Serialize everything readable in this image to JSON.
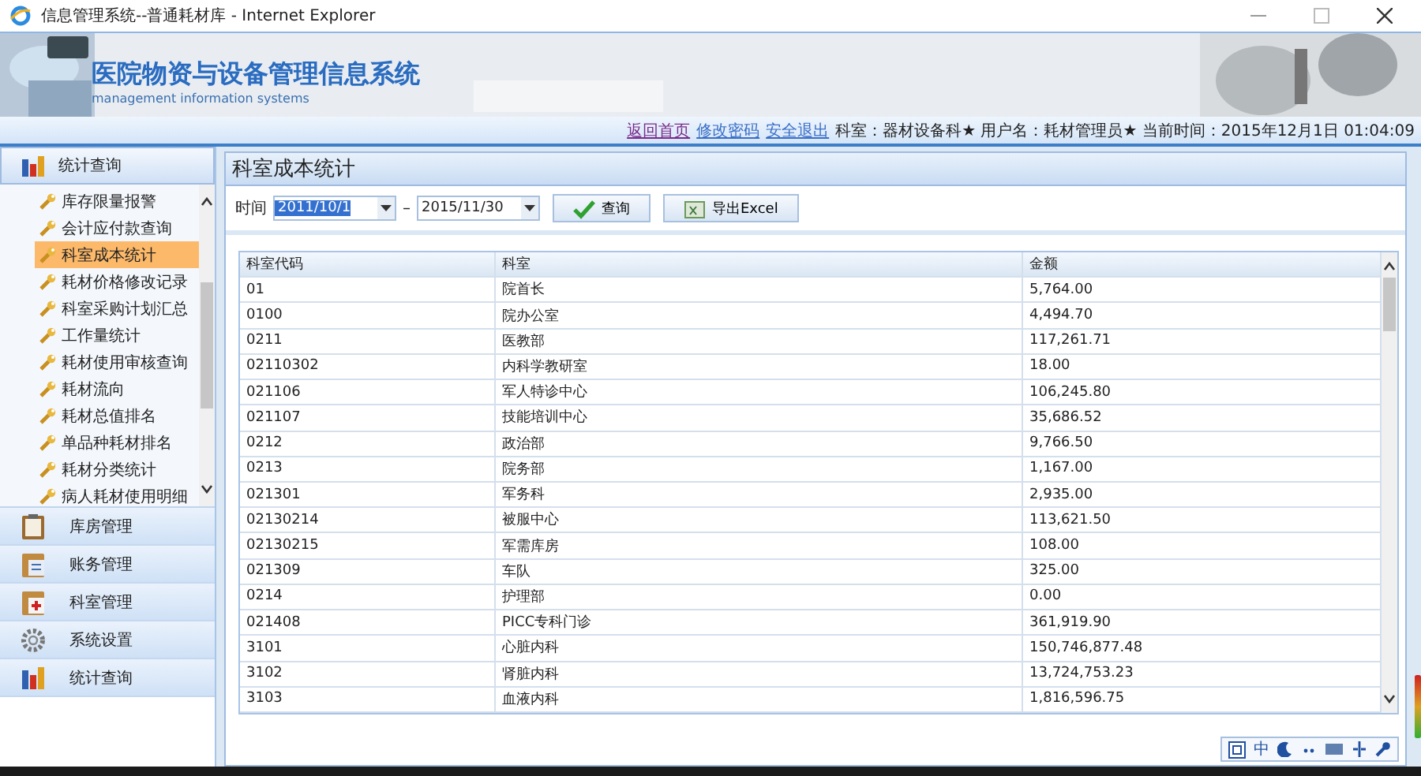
{
  "window": {
    "title": "信息管理系统--普通耗材库 - Internet Explorer"
  },
  "banner": {
    "title": "医院物资与设备管理信息系统",
    "subtitle": "management information systems"
  },
  "info_bar": {
    "links": [
      "返回首页",
      "修改密码",
      "安全退出"
    ],
    "status": "科室：器材设备科★ 用户名：耗材管理员★ 当前时间：2015年12月1日 01:04:09"
  },
  "sidebar": {
    "header": "统计查询",
    "items": [
      {
        "label": "库存限量报警",
        "selected": false
      },
      {
        "label": "会计应付款查询",
        "selected": false
      },
      {
        "label": "科室成本统计",
        "selected": true
      },
      {
        "label": "耗材价格修改记录",
        "selected": false
      },
      {
        "label": "科室采购计划汇总",
        "selected": false
      },
      {
        "label": "工作量统计",
        "selected": false
      },
      {
        "label": "耗材使用审核查询",
        "selected": false
      },
      {
        "label": "耗材流向",
        "selected": false
      },
      {
        "label": "耗材总值排名",
        "selected": false
      },
      {
        "label": "单品种耗材排名",
        "selected": false
      },
      {
        "label": "耗材分类统计",
        "selected": false
      },
      {
        "label": "病人耗材使用明细",
        "selected": false
      }
    ],
    "groups": [
      {
        "label": "库房管理",
        "kind": "clipboard"
      },
      {
        "label": "账务管理",
        "kind": "ledger"
      },
      {
        "label": "科室管理",
        "kind": "medical"
      },
      {
        "label": "系统设置",
        "kind": "gear"
      },
      {
        "label": "统计查询",
        "kind": "chart"
      }
    ]
  },
  "panel": {
    "title": "科室成本统计",
    "time_label": "时间",
    "start_date": "2011/10/1",
    "separator": "–",
    "end_date": "2015/11/30",
    "buttons": [
      {
        "label": "查询",
        "kind": "query"
      },
      {
        "label": "导出Excel",
        "kind": "excel"
      }
    ]
  },
  "table": {
    "columns": [
      "科室代码",
      "科室",
      "金额"
    ],
    "rows": [
      [
        "01",
        "院首长",
        "5,764.00"
      ],
      [
        "0100",
        "院办公室",
        "4,494.70"
      ],
      [
        "0211",
        "医教部",
        "117,261.71"
      ],
      [
        "02110302",
        "内科学教研室",
        "18.00"
      ],
      [
        "021106",
        "军人特诊中心",
        "106,245.80"
      ],
      [
        "021107",
        "技能培训中心",
        "35,686.52"
      ],
      [
        "0212",
        "政治部",
        "9,766.50"
      ],
      [
        "0213",
        "院务部",
        "1,167.00"
      ],
      [
        "021301",
        "军务科",
        "2,935.00"
      ],
      [
        "02130214",
        "被服中心",
        "113,621.50"
      ],
      [
        "02130215",
        "军需库房",
        "108.00"
      ],
      [
        "021309",
        "车队",
        "325.00"
      ],
      [
        "0214",
        "护理部",
        "0.00"
      ],
      [
        "021408",
        "PICC专科门诊",
        "361,919.90"
      ],
      [
        "3101",
        "心脏内科",
        "150,746,877.48"
      ],
      [
        "3102",
        "肾脏内科",
        "13,724,753.23"
      ],
      [
        "3103",
        "血液内科",
        "1,816,596.75"
      ]
    ]
  },
  "ime_bar": {
    "mode": "中"
  }
}
